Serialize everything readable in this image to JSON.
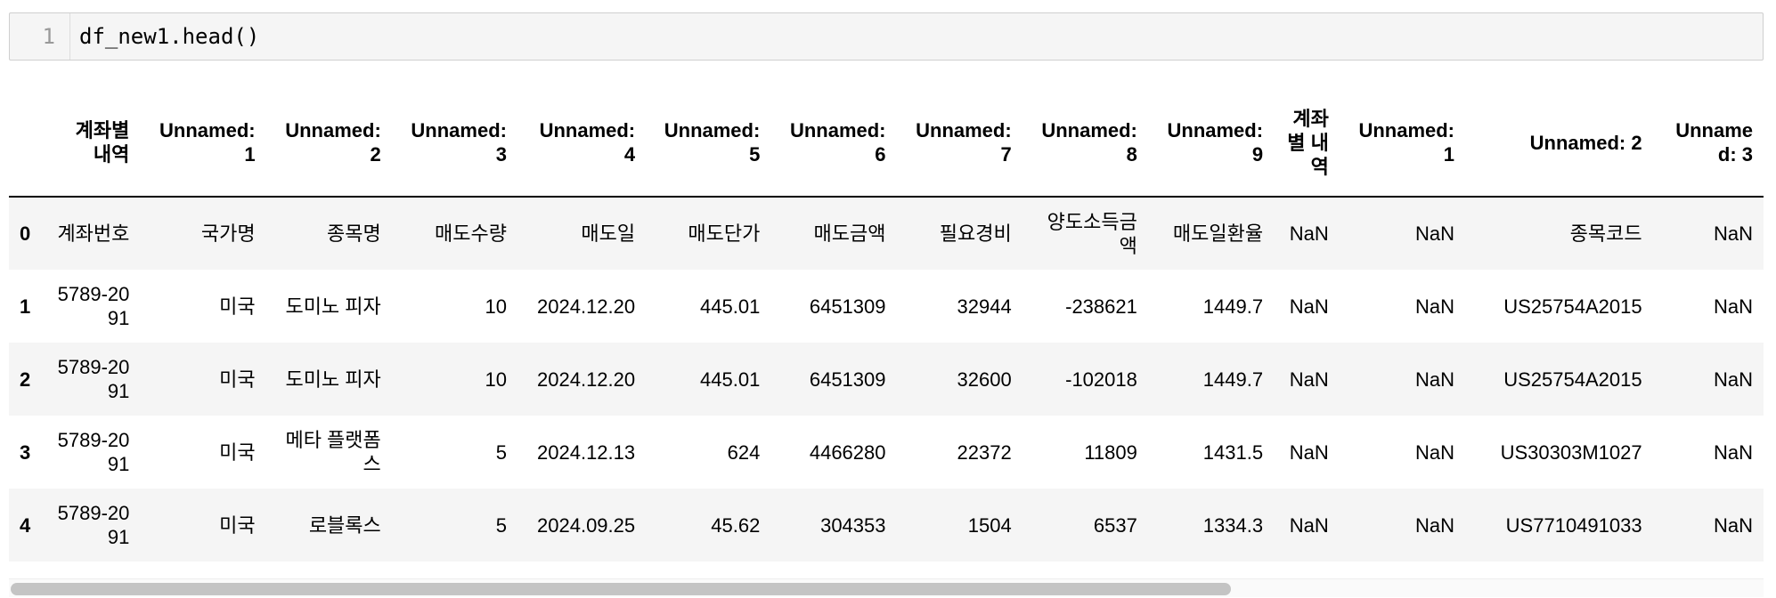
{
  "input": {
    "line_number": "1",
    "code": "df_new1.head()"
  },
  "table": {
    "headers": [
      "",
      "계좌별 내역",
      "Unnamed: 1",
      "Unnamed: 2",
      "Unnamed: 3",
      "Unnamed: 4",
      "Unnamed: 5",
      "Unnamed: 6",
      "Unnamed: 7",
      "Unnamed: 8",
      "Unnamed: 9",
      "계좌별 내역",
      "Unnamed: 1",
      "Unnamed: 2",
      "Unnamed: 3"
    ],
    "rows": [
      [
        "0",
        "계좌번호",
        "국가명",
        "종목명",
        "매도수량",
        "매도일",
        "매도단가",
        "매도금액",
        "필요경비",
        "양도소득금액",
        "매도일환율",
        "NaN",
        "NaN",
        "종목코드",
        "NaN"
      ],
      [
        "1",
        "5789-2091",
        "미국",
        "도미노 피자",
        "10",
        "2024.12.20",
        "445.01",
        "6451309",
        "32944",
        "-238621",
        "1449.7",
        "NaN",
        "NaN",
        "US25754A2015",
        "NaN"
      ],
      [
        "2",
        "5789-2091",
        "미국",
        "도미노 피자",
        "10",
        "2024.12.20",
        "445.01",
        "6451309",
        "32600",
        "-102018",
        "1449.7",
        "NaN",
        "NaN",
        "US25754A2015",
        "NaN"
      ],
      [
        "3",
        "5789-2091",
        "미국",
        "메타 플랫폼스",
        "5",
        "2024.12.13",
        "624",
        "4466280",
        "22372",
        "11809",
        "1431.5",
        "NaN",
        "NaN",
        "US30303M1027",
        "NaN"
      ],
      [
        "4",
        "5789-2091",
        "미국",
        "로블록스",
        "5",
        "2024.09.25",
        "45.62",
        "304353",
        "1504",
        "6537",
        "1334.3",
        "NaN",
        "NaN",
        "US7710491033",
        "NaN"
      ]
    ]
  }
}
